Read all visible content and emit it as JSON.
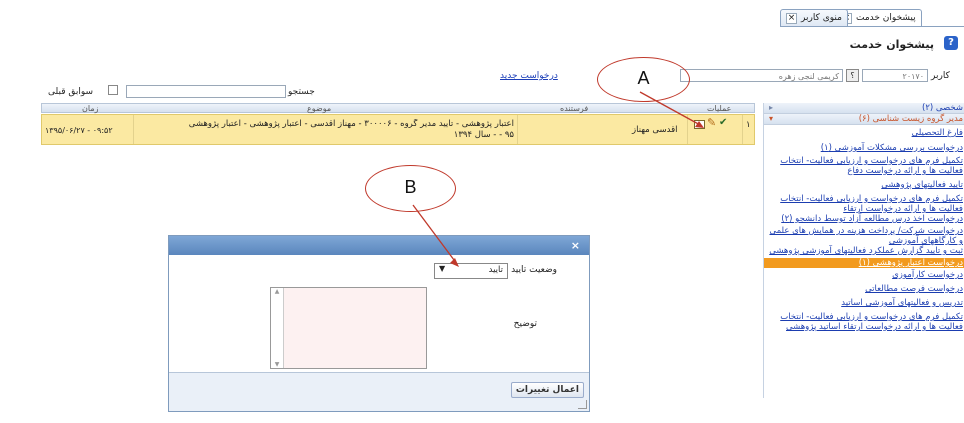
{
  "tabs": [
    {
      "label": "منوی کاربر",
      "close": "×"
    },
    {
      "label": "پیشخوان خدمت",
      "close": "×"
    }
  ],
  "page_title": "پیشخوان خدمت",
  "help_icon": "?",
  "filter": {
    "user_label": "کاربر",
    "user_code": "۲۰۱۷۰",
    "lookup_button": "؟",
    "user_name": "کریمی لنجی زهره",
    "new_request_link": "درخواست جدید",
    "search_label": "جستجو",
    "search_value": "",
    "history_checkbox_label": "سوابق قبلی"
  },
  "grid": {
    "headers": {
      "ops": "عملیات",
      "sender": "فرستنده",
      "subject": "موضوع",
      "time": "زمان"
    },
    "rows": [
      {
        "num": "۱",
        "sender": "اقدسی مهناز",
        "subject_line1": "اعتبار پژوهشی - تایید مدیر گروه - ۳۰۰۰۰۶ - مهناز اقدسی - اعتبار پژوهشی - اعتبار پژوهشی",
        "subject_line2": "۹۵ - - سال ۱۳۹۴",
        "time": "۱۳۹۵/۰۶/۲۷ - ۰۹:۵۲"
      }
    ]
  },
  "side": {
    "headers": [
      {
        "label": "شخصی (۲)",
        "arrow": "▸"
      },
      {
        "label": "مدیر گروه زیست شناسی (۶)",
        "arrow": "▾"
      }
    ],
    "items": [
      {
        "label": "فارغ التحصیلی"
      },
      {
        "label": "درخواست بررسی مشکلات آموزشی (۱)"
      },
      {
        "label": "تکمیل فرم های درخواست و ارزیابی فعالیت- انتخاب فعالیت ها و ارائه درخواست دفاع"
      },
      {
        "label": "تایید فعالیتهای پژوهشی"
      },
      {
        "label": "تکمیل فرم های درخواست و ارزیابی فعالیت- انتخاب فعالیت ها و ارائه درخواست ارتقاء"
      },
      {
        "label": "درخواست اخذ درس مطالعه آزاد توسط دانشجو (۲)"
      },
      {
        "label": "درخواست شرکت/ پرداخت هزینه در همایش های علمی و کارگاههای آموزشی"
      },
      {
        "label": "ثبت و تایید گزارش عملکرد فعالیتهای آموزشی پژوهشی"
      },
      {
        "label": "درخواست اعتبار پژوهشی (۱)",
        "selected": true
      },
      {
        "label": "درخواست کارآموزی"
      },
      {
        "label": "درخواست فرصت مطالعاتی"
      },
      {
        "label": "تدریس و فعالیتهای آموزشی اساتید"
      },
      {
        "label": "تکمیل فرم های درخواست و ارزیابی فعالیت- انتخاب فعالیت ها و ارائه درخواست ارتقاء اساتید پژوهشی"
      }
    ]
  },
  "dialog": {
    "close": "×",
    "status_label": "وضعیت تایید",
    "status_value": "تایید",
    "description_label": "توضیح",
    "apply_button": "اعمال تغییرات"
  },
  "callouts": {
    "a": "A",
    "b": "B"
  },
  "colors": {
    "row_highlight": "#fbe9a2",
    "selected_item": "#f29a1e",
    "callout": "#c0392b"
  }
}
